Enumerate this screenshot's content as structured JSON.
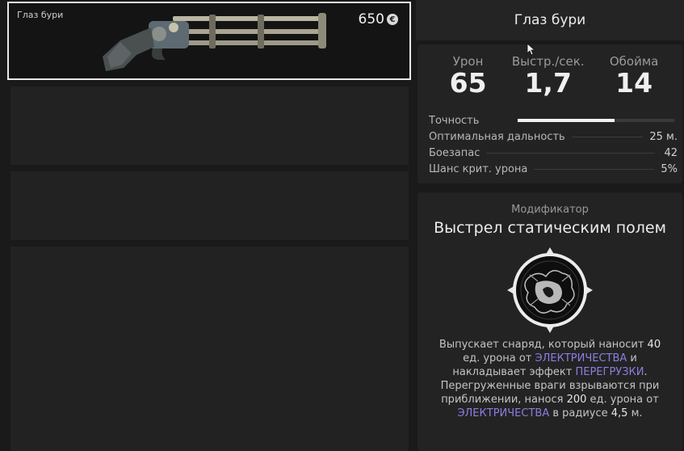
{
  "weapon": {
    "name": "Глаз бури",
    "price": "650",
    "currency_symbol": "€"
  },
  "details": {
    "title": "Глаз бури",
    "big_stats": [
      {
        "label": "Урон",
        "value": "65"
      },
      {
        "label": "Выстр./сек.",
        "value": "1,7"
      },
      {
        "label": "Обойма",
        "value": "14"
      }
    ],
    "accuracy": {
      "label": "Точность",
      "level": 0.62
    },
    "rows": [
      {
        "label": "Оптимальная дальность",
        "value": "25 м."
      },
      {
        "label": "Боезапас",
        "value": "42"
      },
      {
        "label": "Шанс крит. урона",
        "value": "5%"
      }
    ]
  },
  "modifier": {
    "kicker": "Модификатор",
    "name": "Выстрел статическим полем",
    "icon": "static-field-emblem-icon",
    "description": {
      "p1": "Выпускает снаряд, который наносит ",
      "n1": "40",
      "p2": " ед. урона от ",
      "h1": "ЭЛЕКТРИЧЕСТВА",
      "p3": " и накладывает эффект ",
      "h2": "ПЕРЕГРУЗКИ",
      "p4": ". Перегруженные враги взрываются при приближении, нанося ",
      "n2": "200",
      "p5": " ед. урона от ",
      "h3": "ЭЛЕКТРИЧЕСТВА",
      "p6": " в радиусе ",
      "n3": "4,5",
      "p7": " м."
    }
  },
  "colors": {
    "highlight": "#8a7fe0",
    "panel": "#232323",
    "background": "#1a1a1a"
  }
}
